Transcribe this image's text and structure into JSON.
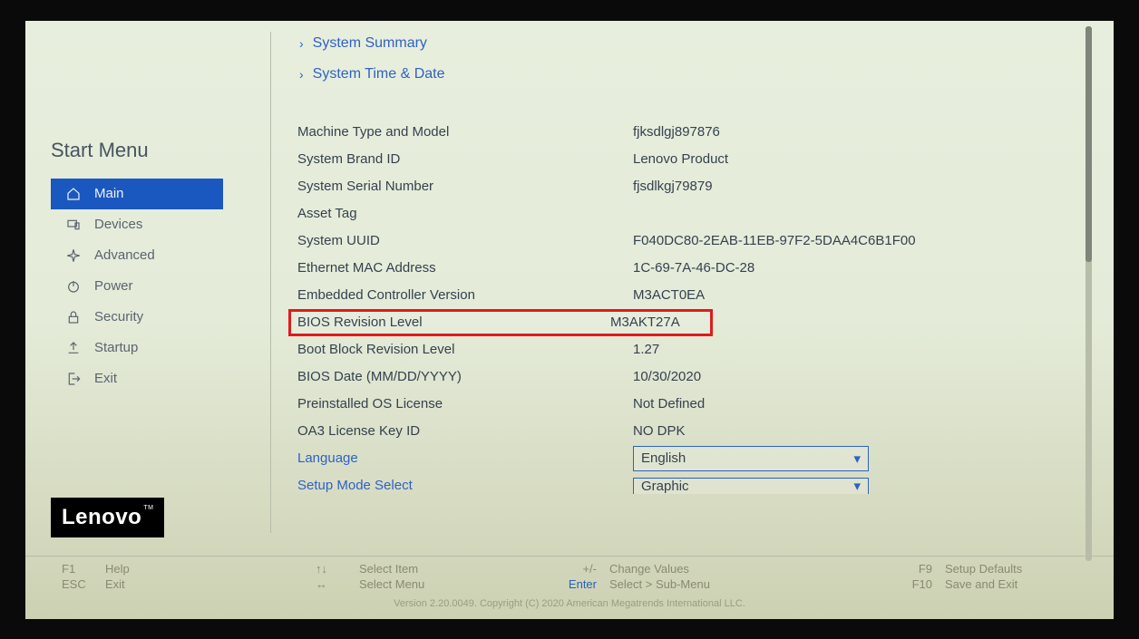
{
  "sidebar": {
    "title": "Start Menu",
    "items": [
      {
        "label": "Main",
        "icon": "home-icon",
        "active": true
      },
      {
        "label": "Devices",
        "icon": "devices-icon",
        "active": false
      },
      {
        "label": "Advanced",
        "icon": "spark-icon",
        "active": false
      },
      {
        "label": "Power",
        "icon": "power-icon",
        "active": false
      },
      {
        "label": "Security",
        "icon": "lock-icon",
        "active": false
      },
      {
        "label": "Startup",
        "icon": "upload-icon",
        "active": false
      },
      {
        "label": "Exit",
        "icon": "exit-icon",
        "active": false
      }
    ]
  },
  "logo": "Lenovo",
  "submenus": {
    "summary": "System Summary",
    "timedate": "System Time & Date"
  },
  "info": {
    "machine_type_label": "Machine Type and Model",
    "machine_type_value": "fjksdlgj897876",
    "brand_label": "System Brand ID",
    "brand_value": "Lenovo Product",
    "serial_label": "System Serial Number",
    "serial_value": "fjsdlkgj79879",
    "asset_label": "Asset Tag",
    "asset_value": "",
    "uuid_label": "System UUID",
    "uuid_value": "F040DC80-2EAB-11EB-97F2-5DAA4C6B1F00",
    "mac_label": "Ethernet MAC Address",
    "mac_value": "1C-69-7A-46-DC-28",
    "ec_label": "Embedded Controller Version",
    "ec_value": "M3ACT0EA",
    "bios_rev_label": "BIOS Revision Level",
    "bios_rev_value": "M3AKT27A",
    "boot_block_label": "Boot Block Revision Level",
    "boot_block_value": "1.27",
    "bios_date_label": "BIOS Date (MM/DD/YYYY)",
    "bios_date_value": "10/30/2020",
    "os_license_label": "Preinstalled OS License",
    "os_license_value": "Not Defined",
    "oa3_label": "OA3 License Key ID",
    "oa3_value": "NO DPK",
    "language_label": "Language",
    "language_value": "English",
    "setup_mode_label": "Setup Mode Select",
    "setup_mode_value": "Graphic"
  },
  "footer": {
    "f1": {
      "key": "F1",
      "label": "Help"
    },
    "esc": {
      "key": "ESC",
      "label": "Exit"
    },
    "select_item": {
      "key": "↑↓",
      "label": "Select Item"
    },
    "select_menu": {
      "key": "↔",
      "label": "Select Menu"
    },
    "change_values": {
      "key": "+/-",
      "label": "Change Values"
    },
    "enter": {
      "key": "Enter",
      "label": "Select > Sub-Menu"
    },
    "f9": {
      "key": "F9",
      "label": "Setup Defaults"
    },
    "f10": {
      "key": "F10",
      "label": "Save and Exit"
    },
    "copyright": "Version 2.20.0049. Copyright (C) 2020 American Megatrends International LLC."
  }
}
